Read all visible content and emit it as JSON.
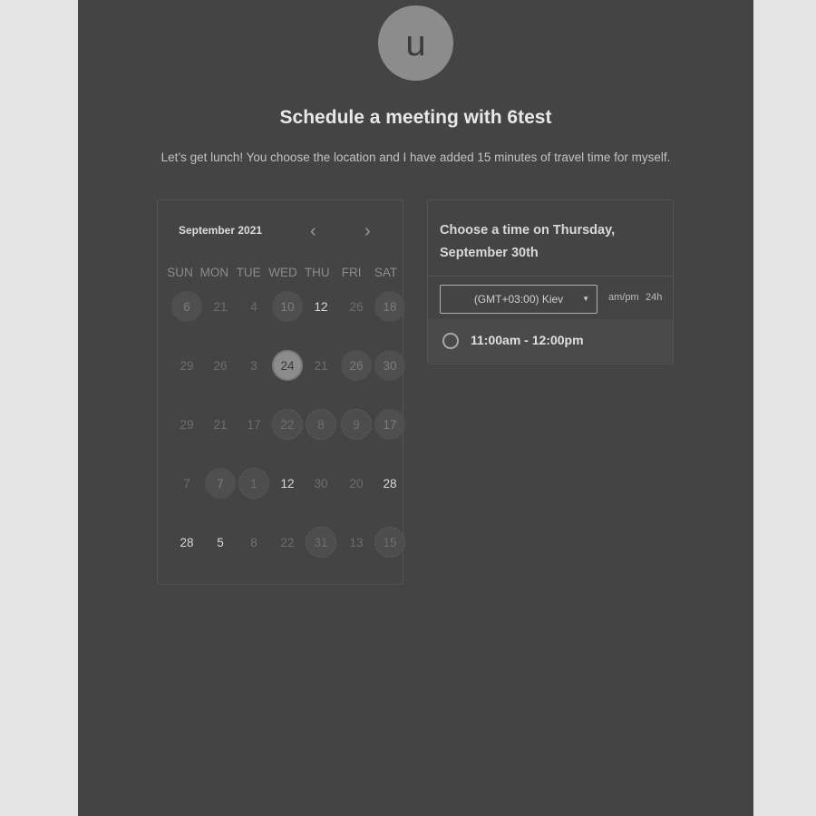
{
  "avatar_letter": "u",
  "title": "Schedule a meeting with 6test",
  "description": "Let’s get lunch! You choose the location and I have added 15 minutes of travel time for myself.",
  "calendar": {
    "month_label": "September 2021",
    "prev_icon": "‹",
    "next_icon": "›",
    "days_of_week": [
      "SUN",
      "MON",
      "TUE",
      "WED",
      "THU",
      "FRI",
      "SAT"
    ],
    "weeks": [
      [
        {
          "label": "6",
          "style": "avail"
        },
        {
          "label": "21",
          "style": "plain"
        },
        {
          "label": "4",
          "style": "plain"
        },
        {
          "label": "10",
          "style": "avail"
        },
        {
          "label": "12",
          "style": "bright"
        },
        {
          "label": "26",
          "style": "plain"
        },
        {
          "label": "18",
          "style": "avail"
        }
      ],
      [
        {
          "label": "29",
          "style": "plain"
        },
        {
          "label": "26",
          "style": "plain"
        },
        {
          "label": "3",
          "style": "plain"
        },
        {
          "label": "24",
          "style": "selected"
        },
        {
          "label": "21",
          "style": "plain"
        },
        {
          "label": "26",
          "style": "avail"
        },
        {
          "label": "30",
          "style": "avail"
        }
      ],
      [
        {
          "label": "29",
          "style": "plain"
        },
        {
          "label": "21",
          "style": "plain"
        },
        {
          "label": "17",
          "style": "plain"
        },
        {
          "label": "22",
          "style": "textured"
        },
        {
          "label": "8",
          "style": "textured"
        },
        {
          "label": "9",
          "style": "textured"
        },
        {
          "label": "17",
          "style": "avail"
        }
      ],
      [
        {
          "label": "7",
          "style": "plain"
        },
        {
          "label": "7",
          "style": "avail"
        },
        {
          "label": "1",
          "style": "textured"
        },
        {
          "label": "12",
          "style": "bright"
        },
        {
          "label": "30",
          "style": "plain"
        },
        {
          "label": "20",
          "style": "plain"
        },
        {
          "label": "28",
          "style": "bright"
        }
      ],
      [
        {
          "label": "28",
          "style": "bright"
        },
        {
          "label": "5",
          "style": "bright"
        },
        {
          "label": "8",
          "style": "plain"
        },
        {
          "label": "22",
          "style": "plain"
        },
        {
          "label": "31",
          "style": "textured"
        },
        {
          "label": "13",
          "style": "plain"
        },
        {
          "label": "15",
          "style": "textured"
        }
      ]
    ]
  },
  "time_panel": {
    "heading": "Choose a time on Thursday, September 30th",
    "timezone": "(GMT+03:00) Kiev",
    "caret_icon": "▼",
    "format_ampm": "am/pm",
    "format_24h": "24h",
    "slots": [
      {
        "label": "11:00am - 12:00pm"
      }
    ]
  }
}
